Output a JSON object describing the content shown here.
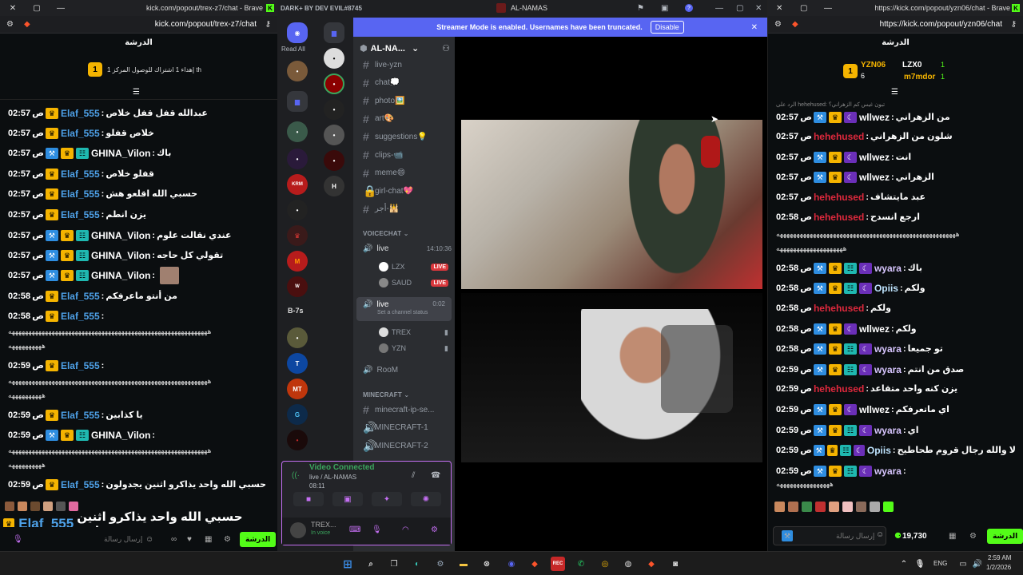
{
  "left_browser": {
    "tab_title": "kick.com/popout/trex-z7/chat - Brave",
    "url": "kick.com/popout/trex-z7/chat",
    "leaderboard_title": "الدرشة",
    "gift_count": "1",
    "gift_text": "إهداء 1 اشتراك للوصول المركز 1 th",
    "messages": [
      {
        "time": "02:57",
        "pm": "ص",
        "user": "Elaf_555",
        "color": "#4ea1e8",
        "text": "عبدالله قفل قفل خلاص"
      },
      {
        "time": "02:57",
        "pm": "ص",
        "user": "Elaf_555",
        "color": "#4ea1e8",
        "text": "خلاص قفلو"
      },
      {
        "time": "02:57",
        "pm": "ص",
        "user": "GHINA_Vilon",
        "color": "#ffffff",
        "text": "باك"
      },
      {
        "time": "02:57",
        "pm": "ص",
        "user": "Elaf_555",
        "color": "#4ea1e8",
        "text": "قفلو خلاص"
      },
      {
        "time": "02:57",
        "pm": "ص",
        "user": "Elaf_555",
        "color": "#4ea1e8",
        "text": "حسبي الله اقلعو هش"
      },
      {
        "time": "02:57",
        "pm": "ص",
        "user": "Elaf_555",
        "color": "#4ea1e8",
        "text": "يزن انطم"
      },
      {
        "time": "02:57",
        "pm": "ص",
        "user": "GHINA_Vilon",
        "color": "#ffffff",
        "text": "عندي نقالت علوم"
      },
      {
        "time": "02:57",
        "pm": "ص",
        "user": "GHINA_Vilon",
        "color": "#ffffff",
        "text": "تقولي كل حاجه"
      },
      {
        "time": "02:57",
        "pm": "ص",
        "user": "GHINA_Vilon",
        "color": "#ffffff",
        "text": ""
      },
      {
        "time": "02:58",
        "pm": "ص",
        "user": "Elaf_555",
        "color": "#4ea1e8",
        "text": "من أنتو ماعرفكم"
      },
      {
        "time": "02:58",
        "pm": "ص",
        "user": "Elaf_555",
        "color": "#4ea1e8",
        "text": ""
      },
      {
        "time": "02:59",
        "pm": "ص",
        "user": "Elaf_555",
        "color": "#4ea1e8",
        "text": ""
      },
      {
        "time": "02:59",
        "pm": "ص",
        "user": "Elaf_555",
        "color": "#4ea1e8",
        "text": "يا كذابين"
      },
      {
        "time": "02:59",
        "pm": "ص",
        "user": "GHINA_Vilon",
        "color": "#ffffff",
        "text": ""
      },
      {
        "time": "02:59",
        "pm": "ص",
        "user": "Elaf_555",
        "color": "#4ea1e8",
        "text": "حسبي الله واحد يذاكرو اثنين يجدولون"
      }
    ],
    "long_line": "ههههههههههههههههههههههههههههههههههههههههههههههههههههههههههههه",
    "long_line_short": "ههههههههههه",
    "overlay_user": "Elaf_555",
    "overlay_text": "حسبي الله واحد يذاكرو اثنين يجدولون :",
    "input_placeholder": "إرسال رسالة",
    "chat_button": "الدرشة"
  },
  "discord": {
    "brand": "DARK+ BY DEV EVIL#8745",
    "server_title": "AL-NAMAS",
    "banner_text": "Streamer Mode is enabled. Usernames have been truncated.",
    "banner_button": "Disable",
    "read_all": "Read All",
    "guild_label": "B-7s",
    "server_name": "AL-NA...",
    "text_channels": [
      "live-yzn",
      "chat💭",
      "photo🖼️",
      "art🎨",
      "suggestions💡",
      "clips-📹",
      "meme😄",
      "girl-chat💖",
      "أجر-🕌"
    ],
    "voice_category": "VOICECHAT",
    "voice_time": "14:10:36",
    "voice1": "live",
    "voice1_users": [
      {
        "name": "LZX",
        "badge": "LIVE"
      },
      {
        "name": "SAUD",
        "badge": "LIVE"
      }
    ],
    "voice2": "live",
    "voice2_time": "0:02",
    "voice2_status": "Set a channel status",
    "voice2_users": [
      "TREX",
      "YZN"
    ],
    "voice3": "RooM",
    "mc_category": "MINECRAFT",
    "mc_channels": [
      "minecraft-ip-se...",
      "MINECRAFT-1",
      "MINECRAFT-2"
    ],
    "vc_title": "Video Connected",
    "vc_sub": "live / AL-NAMAS",
    "vc_time": "08:11",
    "user_name": "TREX...",
    "user_status": "In voice"
  },
  "right_browser": {
    "tab_title": "https://kick.com/popout/yzn06/chat - Brave",
    "url": "https://kick.com/popout/yzn06/chat",
    "leaderboard_title": "الدرشة",
    "lb_count": "1",
    "lb_users": [
      "YZN06",
      "LZX0",
      "m7mdor"
    ],
    "lb_subs": [
      "6",
      "1",
      "1"
    ],
    "reply_text": "الرد على hehehused: تبون غيس كم الزهراني؟",
    "messages": [
      {
        "time": "02:57",
        "pm": "ص",
        "user": "wllwez",
        "color": "#ffffff",
        "text": "من الزهراني"
      },
      {
        "time": "02:57",
        "pm": "ص",
        "user": "hehehused",
        "color": "#e0293d",
        "text": "شلون من الزهراني"
      },
      {
        "time": "02:57",
        "pm": "ص",
        "user": "wllwez",
        "color": "#ffffff",
        "text": "انت"
      },
      {
        "time": "02:57",
        "pm": "ص",
        "user": "wllwez",
        "color": "#ffffff",
        "text": "الزهراني"
      },
      {
        "time": "02:57",
        "pm": "ص",
        "user": "hehehused",
        "color": "#e0293d",
        "text": "عبد مايتشاف"
      },
      {
        "time": "02:58",
        "pm": "ص",
        "user": "hehehused",
        "color": "#e0293d",
        "text": "ارجع انسدح"
      },
      {
        "time": "02:58",
        "pm": "ص",
        "user": "wyara",
        "color": "#d8c6ff",
        "text": "باك"
      },
      {
        "time": "02:58",
        "pm": "ص",
        "user": "Opiis",
        "color": "#bfe4ff",
        "text": "ولكم"
      },
      {
        "time": "02:58",
        "pm": "ص",
        "user": "hehehused",
        "color": "#e0293d",
        "text": "ولكم"
      },
      {
        "time": "02:58",
        "pm": "ص",
        "user": "wllwez",
        "color": "#ffffff",
        "text": "ولكم"
      },
      {
        "time": "02:58",
        "pm": "ص",
        "user": "wyara",
        "color": "#d8c6ff",
        "text": "تو جميعا"
      },
      {
        "time": "02:59",
        "pm": "ص",
        "user": "wyara",
        "color": "#d8c6ff",
        "text": "صدق من انتم"
      },
      {
        "time": "02:59",
        "pm": "ص",
        "user": "hehehused",
        "color": "#e0293d",
        "text": "يزن كنه واحد متقاعد"
      },
      {
        "time": "02:59",
        "pm": "ص",
        "user": "wllwez",
        "color": "#ffffff",
        "text": "اي ماتعرفكم"
      },
      {
        "time": "02:59",
        "pm": "ص",
        "user": "wyara",
        "color": "#d8c6ff",
        "text": "اي"
      },
      {
        "time": "02:59",
        "pm": "ص",
        "user": "Opiis",
        "color": "#bfe4ff",
        "text": "لا والله رجال قروم طحاطيح"
      },
      {
        "time": "02:59",
        "pm": "ص",
        "user": "wyara",
        "color": "#d8c6ff",
        "text": ""
      }
    ],
    "long_line": "ههههههههههههههههههههههههههههههههههههههههههههههههههههههه",
    "long_line_short": "ههههههههههههههههههههه",
    "long_line3": "ههههههههههههههههه",
    "input_placeholder": "إرسال رسالة",
    "points": "19,730",
    "chat_button": "الدرشة"
  },
  "taskbar": {
    "time": "2:59 AM",
    "date": "1/2/2026",
    "lang": "ENG"
  }
}
